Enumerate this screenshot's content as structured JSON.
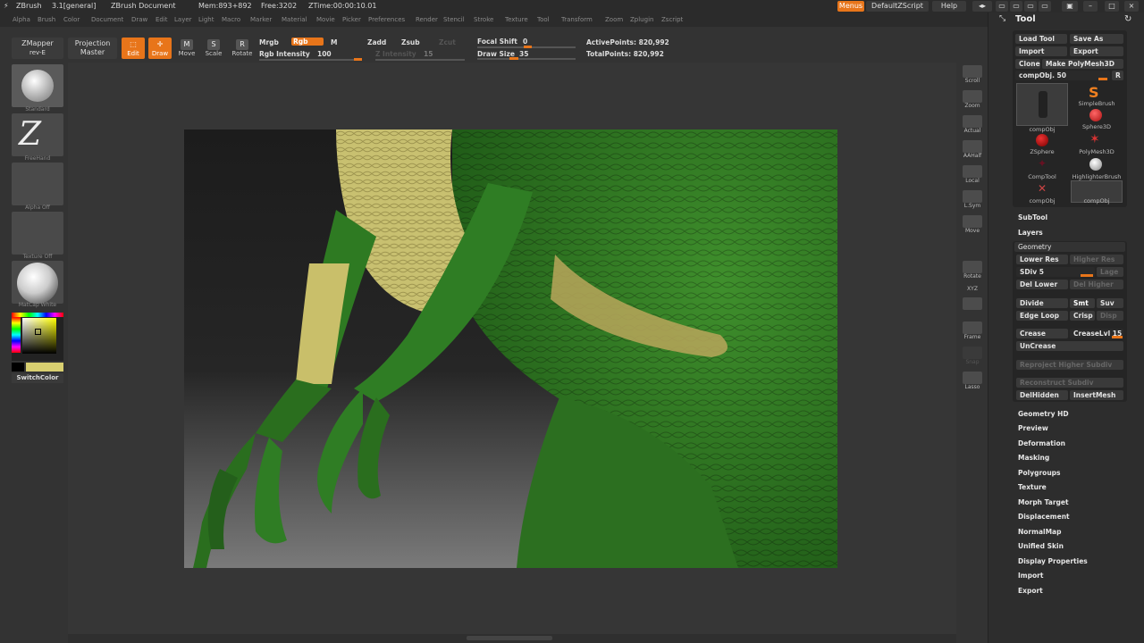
{
  "titlebar": {
    "app": "ZBrush",
    "version": "3.1[general]",
    "document": "ZBrush Document",
    "mem": "Mem:893+892",
    "free": "Free:3202",
    "ztime": "ZTime:00:00:10.01",
    "menus_btn": "Menus",
    "script": "DefaultZScript",
    "help": "Help"
  },
  "menubar": [
    "Alpha",
    "Brush",
    "Color",
    "Document",
    "Draw",
    "Edit",
    "Layer",
    "Light",
    "Macro",
    "Marker",
    "Material",
    "Movie",
    "Picker",
    "Preferences",
    "Render",
    "Stencil",
    "Stroke",
    "Texture",
    "Tool",
    "Transform",
    "Zoom",
    "Zplugin",
    "Zscript"
  ],
  "toolbar": {
    "zmapper": "ZMapper",
    "zmapper_sub": "rev-E",
    "projection": "Projection",
    "projection_sub": "Master",
    "edit": "Edit",
    "draw": "Draw",
    "move": "Move",
    "scale": "Scale",
    "rotate": "Rotate",
    "mrgb": "Mrgb",
    "rgb": "Rgb",
    "m": "M",
    "rgb_intensity_label": "Rgb Intensity",
    "rgb_intensity": "100",
    "zadd": "Zadd",
    "zsub": "Zsub",
    "zcut": "Zcut",
    "z_intensity_label": "Z Intensity",
    "z_intensity": "15",
    "focal_shift_label": "Focal Shift",
    "focal_shift": "0",
    "draw_size_label": "Draw Size",
    "draw_size": "35",
    "active_points": "ActivePoints: 820,992",
    "total_points": "TotalPoints: 820,992"
  },
  "leftshelf": {
    "brush": "Standard",
    "stroke": "FreeHand",
    "alpha": "Alpha Off",
    "texture": "Texture Off",
    "material": "MatCap White",
    "switch_color": "SwitchColor"
  },
  "rightshelf": [
    "Scroll",
    "Zoom",
    "Actual",
    "AAHalf",
    "Local",
    "L.Sym",
    "Move",
    "Rotate",
    "XYZ",
    "",
    "Frame",
    "Snap",
    "Lasso"
  ],
  "toolpanel": {
    "title": "Tool",
    "load_tool": "Load Tool",
    "save_as": "Save As",
    "import": "Import",
    "export": "Export",
    "clone": "Clone",
    "make_polymesh": "Make PolyMesh3D",
    "compobj_slider": "compObj. 50",
    "r_btn": "R",
    "tools": [
      "compObj",
      "SimpleBrush",
      "Sphere3D",
      "ZSphere",
      "PolyMesh3D",
      "CompTool",
      "HighlighterBrush",
      "compObj",
      "compObj"
    ],
    "subtool": "SubTool",
    "layers": "Layers",
    "geometry": "Geometry",
    "lower_res": "Lower Res",
    "higher_res": "Higher Res",
    "sdiv": "SDiv 5",
    "lage": "Lage",
    "del_lower": "Del Lower",
    "del_higher": "Del Higher",
    "divide": "Divide",
    "smt": "Smt",
    "suv": "Suv",
    "edge_loop": "Edge Loop",
    "crisp": "Crisp",
    "disp": "Disp",
    "crease": "Crease",
    "crease_lvl": "CreaseLvl 15",
    "uncrease": "UnCrease",
    "reproject": "Reproject Higher Subdiv",
    "reconstruct": "Reconstruct Subdiv",
    "delhidden": "DelHidden",
    "insertmesh": "InsertMesh",
    "sections": [
      "Geometry HD",
      "Preview",
      "Deformation",
      "Masking",
      "Polygroups",
      "Texture",
      "Morph Target",
      "Displacement",
      "NormalMap",
      "Unified Skin",
      "Display Properties",
      "Import",
      "Export"
    ]
  },
  "colors": {
    "accent": "#e8751a",
    "panel_bg": "#2d2d2d",
    "canvas_bg": "#363636",
    "skin_green": "#2e7a22",
    "skin_yellow": "#c9bf6a"
  }
}
